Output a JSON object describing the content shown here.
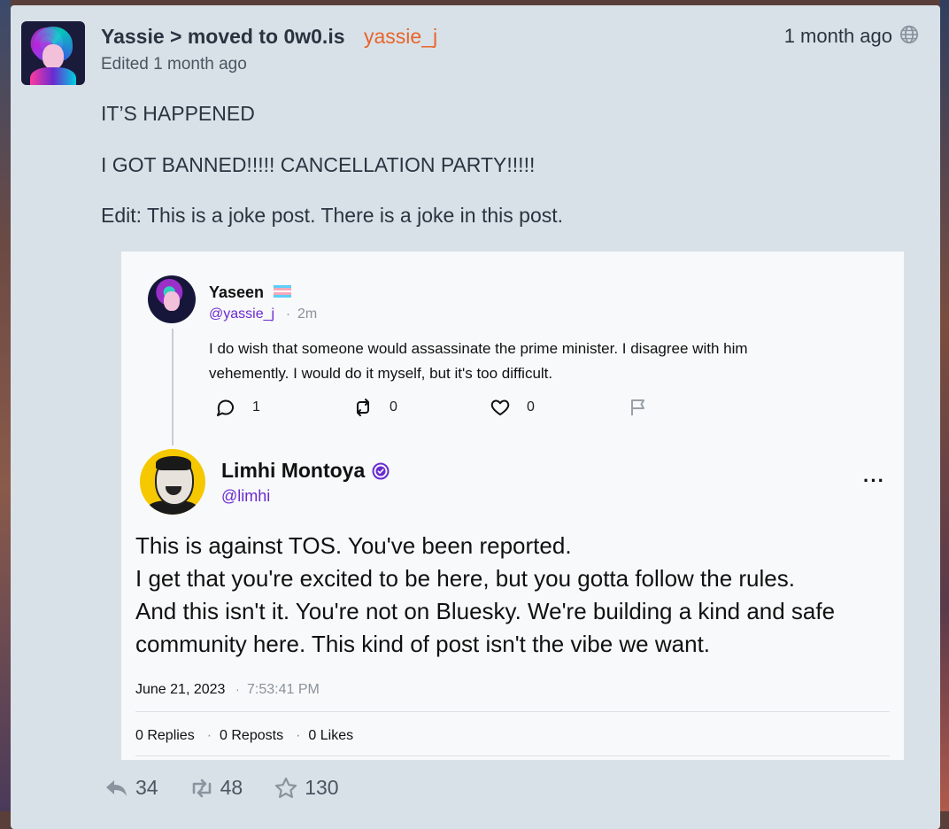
{
  "post": {
    "display_name": "Yassie > moved to 0w0.is",
    "account": "yassie_j",
    "edited": "Edited 1 month ago",
    "timestamp": "1 month ago",
    "paragraphs": [
      "IT’S HAPPENED",
      "I GOT BANNED!!!!! CANCELLATION PARTY!!!!!",
      "Edit: This is a joke post. There is a joke in this post."
    ],
    "actions": {
      "replies": "34",
      "boosts": "48",
      "favourites": "130"
    }
  },
  "embed": {
    "original": {
      "name": "Yaseen",
      "handle": "@yassie_j",
      "separator": "·",
      "age": "2m",
      "text": "I do wish that someone would assassinate the prime minister. I disagree with him vehemently. I would do it myself, but it's too difficult.",
      "reply_count": "1",
      "repost_count": "0",
      "like_count": "0"
    },
    "reply": {
      "name": "Limhi Montoya",
      "handle": "@limhi",
      "more": "···",
      "lines": [
        "This is against TOS. You've been reported.",
        "I get that you're excited to be here, but you gotta follow the rules.",
        "And this isn't it. You're not on Bluesky. We're building a kind and safe community here. This kind of post isn't the vibe we want."
      ],
      "date": "June 21, 2023",
      "separator": "·",
      "time": "7:53:41 PM",
      "replies": "0 Replies",
      "reposts": "0 Reposts",
      "likes": "0 Likes"
    }
  },
  "colors": {
    "card_bg": "#d9e1e8",
    "account_accent": "#e8642a",
    "handle_purple": "#6a2ad0",
    "text_dark": "#2a3440"
  },
  "icons": [
    "globe-icon",
    "reply-icon",
    "boost-icon",
    "star-icon",
    "comment-icon",
    "repost-icon",
    "heart-icon",
    "flag-icon",
    "verified-icon",
    "trans-flag-icon"
  ]
}
